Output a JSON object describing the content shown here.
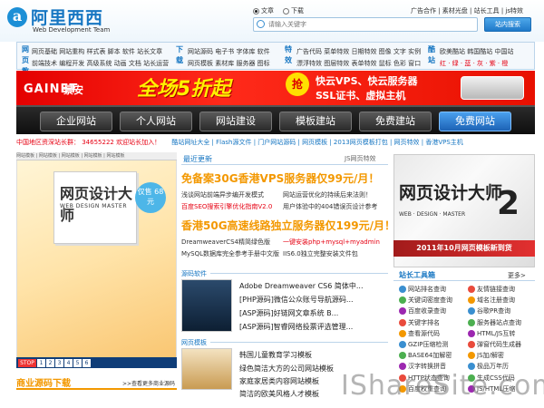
{
  "header": {
    "logo_letter": "a",
    "logo_text": "阿里西西",
    "logo_sub": "Web Development Team",
    "radio_article": "文章",
    "radio_download": "下载",
    "search_placeholder": "请输入关键字",
    "search_button": "站内搜索",
    "top_links": "广告合作 | 素材光盘 | 站长工具 | js特效"
  },
  "nav": {
    "col1_head": "网页教程",
    "col1_row1": "网页基础  网站重构  样式表  脚本  软件  站长文章",
    "col1_row2": "前端技术  编程开发  高级系统  动画  文档  站长运营",
    "col2_head": "下载",
    "col2_row1": "网站源码  电子书  字体库  软件",
    "col2_row2": "网页模板  素材库  服务器  图标",
    "col3_head": "特效",
    "col3_row1": "广告代码  菜单特效  日期特效  图像  文字  实例",
    "col3_row2": "漂浮特效  图层特效  表单特效  鼠标  色彩  窗口",
    "col4_head": "酷站",
    "col4_row1": "欧美酷站  韩国酷站  中国站",
    "col4_row2": "红 · 绿 · 蓝 · 灰 · 紫 · 橙"
  },
  "banner": {
    "brand": "GAINET",
    "brand_cn": "景安",
    "slogan": "全场5折起",
    "sticker": "抢",
    "line1": "快云VPS、快云服务器",
    "line2": "SSL证书、虚拟主机",
    "buttons": [
      "企业网站",
      "个人网站",
      "网站建设",
      "模板建站",
      "免费建站",
      "免费网站"
    ]
  },
  "info_bar": {
    "qq": "中国地区资深站长群： 34655222 欢迎站长加入！",
    "links": "酷站网址大全 | Flash源文件 | 门户网站源码 | 网页模板 | 2013网页模板打包 | 网页特效 | 香港VPS主机"
  },
  "left": {
    "tabs": "网站模板 | 网站模板 | 网站模板 | 网站模板 | 网站模板",
    "book_title": "网页设计大师",
    "book_en": "WEB DESIGN MASTER",
    "price": "仅售 68元",
    "stop": "STOP",
    "pages": [
      "1",
      "2",
      "3",
      "4",
      "5",
      "6"
    ],
    "bottom_title": "商业源码下载",
    "bottom_more": ">>查看更多商业源码"
  },
  "middle": {
    "tab_label": "最近更新",
    "tab_more": "JS网页特效",
    "head1": "免备案30G香港VPS服务器仅99元/月！",
    "rows1": [
      "浅谈网站前端异步编开发模式",
      "网站运营优化的持续后来法则！",
      "百度SEO搜索引擎优化指南V2.0",
      "用户体验中的404错误页设计参考"
    ],
    "head2": "香港50G高速线路独立服务器仅199元/月！",
    "rows2": [
      "DreamweaverCS4精简绿色版",
      "一键安装php+mysql+myadmin",
      "MySQL数据库完全参考手册中文版",
      "IIS6.0独立完整安装文件包"
    ],
    "sec1": "源码软件",
    "items1": [
      "Adobe Dreamweaver CS6 简体中...",
      "[PHP源码]微信公众账号导航源码...",
      "[ASP源码]好链网文章系统 B...",
      "[ASP源码]智睿网络投票评选管理..."
    ],
    "sec2": "网页模板",
    "items2": [
      "韩国儿童教育学习模板",
      "绿色简洁大方的公司网站模板",
      "家庭家居类内容网站模板",
      "简洁的欧美风格人才模板"
    ]
  },
  "right": {
    "title": "网页设计大师",
    "num": "2",
    "en": "WEB · DESIGN · MASTER",
    "date": "2011年10月网页模板新到货",
    "tools_title": "站长工具箱",
    "tools_more": "更多>",
    "tools": [
      "网站排名查询",
      "友情链接查询",
      "关键词密度查询",
      "域名注册查询",
      "百度收录查询",
      "谷歌PR查询",
      "关键字排名",
      "服务器站点查询",
      "查看源代码",
      "HTML/JS互转",
      "GZIP压缩检测",
      "弹窗代码生成器",
      "BASE64加解密",
      "JS加/解密",
      "汉字转换拼音",
      "极品万年历",
      "HTTP状态查询",
      "生成CSS代码",
      "百度权重查询",
      "JS/HTML压缩"
    ],
    "tool_colors": [
      "#3a8fd0",
      "#e94b3c",
      "#4caf50",
      "#f39800",
      "#9c27b0"
    ]
  },
  "watermark": "IShareSite.com"
}
